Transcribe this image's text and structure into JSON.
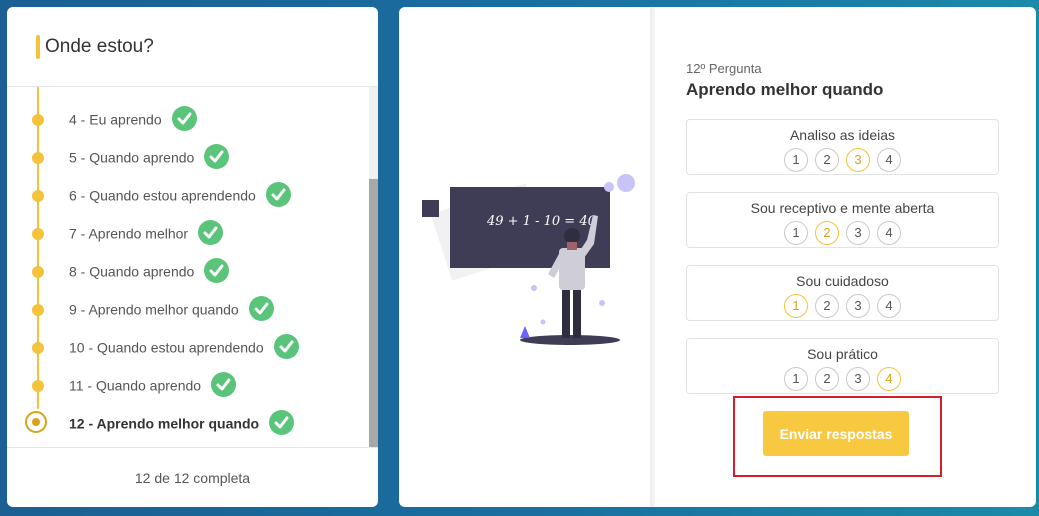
{
  "sidebar": {
    "title": "Onde estou?",
    "steps": [
      {
        "label": "4 - Eu aprendo",
        "done": true
      },
      {
        "label": "5 - Quando aprendo",
        "done": true
      },
      {
        "label": "6 - Quando estou aprendendo",
        "done": true
      },
      {
        "label": "7 - Aprendo melhor",
        "done": true
      },
      {
        "label": "8 - Quando aprendo",
        "done": true
      },
      {
        "label": "9 - Aprendo melhor quando",
        "done": true
      },
      {
        "label": "10 - Quando estou aprendendo",
        "done": true
      },
      {
        "label": "11 - Quando aprendo",
        "done": true
      },
      {
        "label": "12 - Aprendo melhor quando",
        "done": true,
        "current": true
      }
    ],
    "footer": "12 de 12 completa"
  },
  "illustration": {
    "board_text": "49 + 1 - 10 = 40"
  },
  "question": {
    "number": "12º Pergunta",
    "title": "Aprendo melhor quando",
    "options": [
      {
        "label": "Analiso as ideias",
        "selected": 3
      },
      {
        "label": "Sou receptivo e mente aberta",
        "selected": 2
      },
      {
        "label": "Sou cuidadoso",
        "selected": 1
      },
      {
        "label": "Sou prático",
        "selected": 4
      }
    ],
    "scale": [
      "1",
      "2",
      "3",
      "4"
    ]
  },
  "submit": {
    "label": "Enviar respostas"
  },
  "colors": {
    "accent": "#f5c23c",
    "check": "#5ac57a",
    "highlight": "#d41e2b"
  }
}
